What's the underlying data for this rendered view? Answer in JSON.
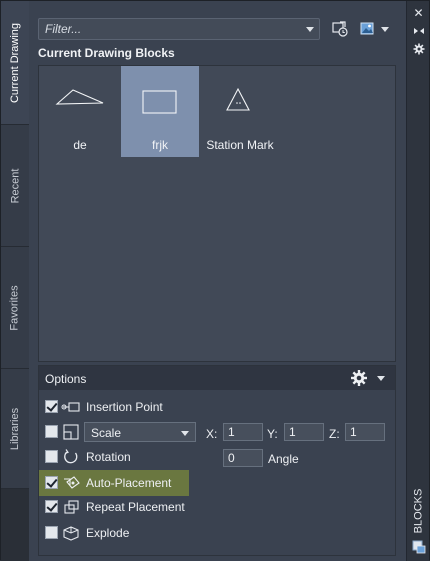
{
  "tabs": [
    {
      "label": "Current Drawing",
      "active": true
    },
    {
      "label": "Recent",
      "active": false
    },
    {
      "label": "Favorites",
      "active": false
    },
    {
      "label": "Libraries",
      "active": false
    }
  ],
  "filter": {
    "placeholder": "Filter..."
  },
  "section_title": "Current Drawing Blocks",
  "blocks": [
    {
      "name": "de",
      "icon": "triangle-block-icon",
      "selected": false
    },
    {
      "name": "frjk",
      "icon": "rectangle-block-icon",
      "selected": true
    },
    {
      "name": "Station Mark",
      "icon": "station-mark-icon",
      "selected": false
    }
  ],
  "options": {
    "title": "Options",
    "insertion_point": {
      "label": "Insertion Point",
      "checked": true
    },
    "scale": {
      "checked": false,
      "mode": "Scale",
      "x_label": "X:",
      "x": "1",
      "y_label": "Y:",
      "y": "1",
      "z_label": "Z:",
      "z": "1"
    },
    "rotation": {
      "label": "Rotation",
      "checked": false,
      "angle_value": "0",
      "angle_label": "Angle"
    },
    "auto_placement": {
      "label": "Auto-Placement",
      "checked": true,
      "highlighted": true
    },
    "repeat_placement": {
      "label": "Repeat Placement",
      "checked": true
    },
    "explode": {
      "label": "Explode",
      "checked": false
    }
  },
  "side_panel": {
    "label": "BLOCKS"
  },
  "colors": {
    "panel": "#3a4250",
    "selected_tile": "#7e90ad",
    "highlight_row": "#6a7740"
  }
}
